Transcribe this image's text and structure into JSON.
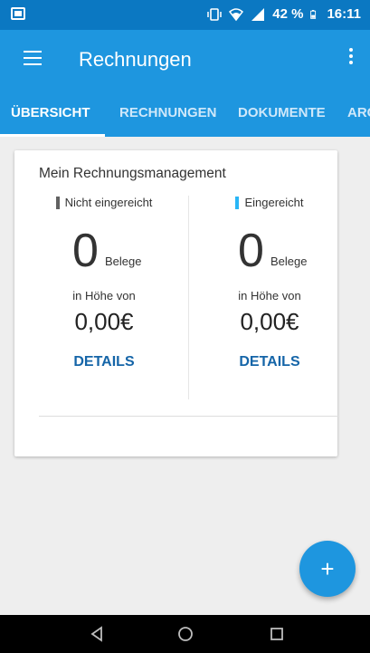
{
  "status_bar": {
    "battery_percent": "42 %",
    "time": "16:11",
    "icons": [
      "notification-image-icon",
      "vibrate-icon",
      "wifi-icon",
      "signal-icon",
      "battery-icon"
    ]
  },
  "app_bar": {
    "title": "Rechnungen",
    "icons": [
      "menu-icon",
      "more-vert-icon"
    ]
  },
  "tabs": [
    {
      "label": "ÜBERSICHT",
      "active": true
    },
    {
      "label": "RECHNUNGEN",
      "active": false
    },
    {
      "label": "DOKUMENTE",
      "active": false
    },
    {
      "label": "ARC",
      "active": false
    }
  ],
  "card": {
    "title": "Mein Rechnungsmanagement",
    "columns": [
      {
        "header": "Nicht eingereicht",
        "marker_color": "#616161",
        "count": "0",
        "count_unit": "Belege",
        "amount_label": "in Höhe von",
        "amount": "0,00€",
        "details_label": "DETAILS"
      },
      {
        "header": "Eingereicht",
        "marker_color": "#29b6f6",
        "count": "0",
        "count_unit": "Belege",
        "amount_label": "in Höhe von",
        "amount": "0,00€",
        "details_label": "DETAILS"
      }
    ]
  },
  "fab": {
    "label": "+",
    "icon": "add-icon"
  },
  "nav_bar": {
    "icons": [
      "back-icon",
      "home-icon",
      "recents-icon"
    ]
  },
  "colors": {
    "primary": "#1e96df",
    "primary_dark": "#0b78c2",
    "accent_link": "#1565a8",
    "submitted_marker": "#29b6f6",
    "not_submitted_marker": "#616161"
  }
}
